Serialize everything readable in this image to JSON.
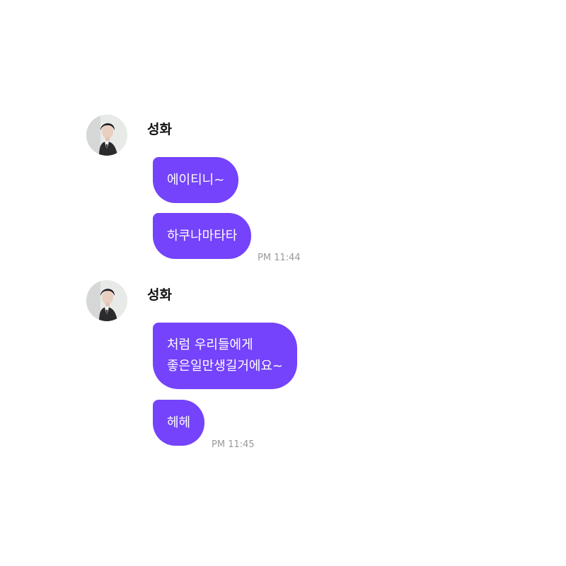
{
  "accent_color": "#7443fb",
  "groups": [
    {
      "sender": "성화",
      "avatar_icon": "profile-photo",
      "messages": [
        {
          "lines": [
            "에이티니~"
          ]
        },
        {
          "lines": [
            "하쿠나마타타"
          ]
        }
      ],
      "time": "PM 11:44"
    },
    {
      "sender": "성화",
      "avatar_icon": "profile-photo",
      "messages": [
        {
          "lines": [
            "처럼 우리들에게",
            "좋은일만생길거에요~"
          ]
        },
        {
          "lines": [
            "헤헤"
          ]
        }
      ],
      "time": "PM 11:45"
    }
  ]
}
